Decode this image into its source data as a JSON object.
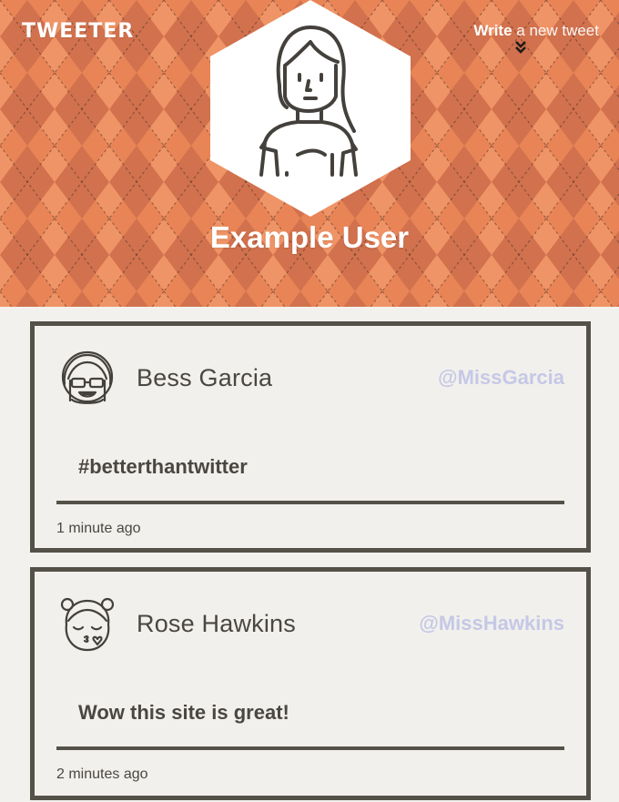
{
  "header": {
    "brand": "TWEETER",
    "compose_bold": "Write",
    "compose_rest": " a new tweet",
    "profile_name": "Example User",
    "colors": {
      "pattern_base": "#e98456",
      "pattern_dark": "#c86a48",
      "pattern_light": "#f29a6c",
      "text": "#ffffff"
    }
  },
  "tweets": [
    {
      "name": "Bess Garcia",
      "handle": "@MissGarcia",
      "body": "#betterthantwitter",
      "time": "1 minute ago",
      "avatar_icon": "girl-with-glasses-icon"
    },
    {
      "name": "Rose Hawkins",
      "handle": "@MissHawkins",
      "body": "Wow this site is great!",
      "time": "2 minutes ago",
      "avatar_icon": "girl-blowing-kiss-icon"
    }
  ]
}
